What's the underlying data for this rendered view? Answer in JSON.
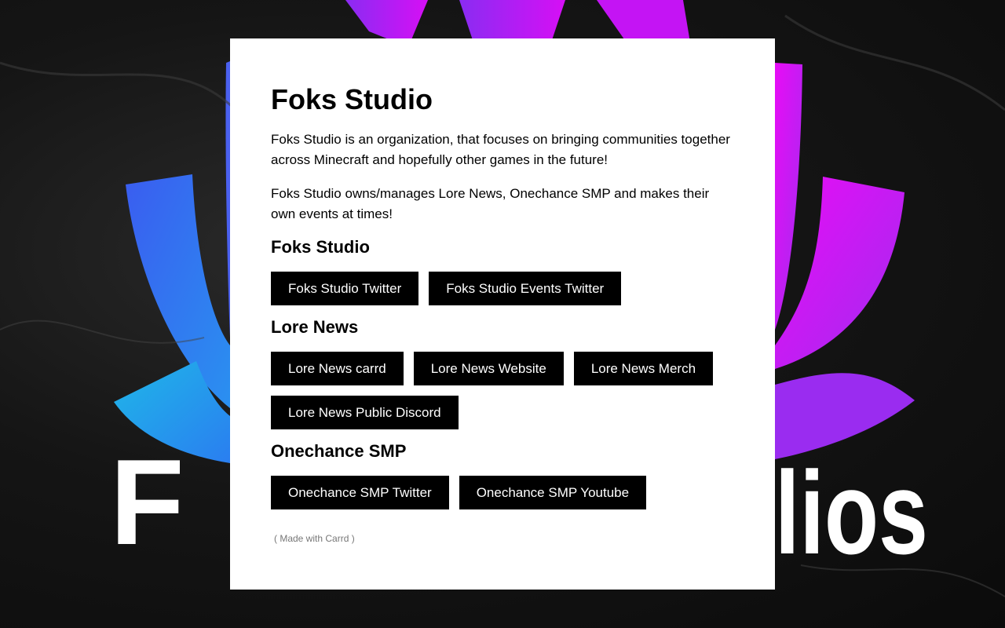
{
  "background": {
    "logo_text_left": "F",
    "logo_text_right": "lios",
    "colors": {
      "petal_blue": "#2f6ef0",
      "petal_cyan": "#19b8e6",
      "petal_purple": "#9b2cf2",
      "petal_magenta": "#e20cf5",
      "card_bg": "#ffffff",
      "button_bg": "#000000",
      "button_text": "#ffffff"
    }
  },
  "header": {
    "title": "Foks Studio"
  },
  "intro": {
    "paragraph_1": "Foks Studio is an organization, that focuses on bringing communities together across Minecraft and hopefully other games in the future!",
    "paragraph_2": "Foks Studio owns/manages Lore News, Onechance SMP and makes their own events at times!"
  },
  "sections": {
    "foks": {
      "heading": "Foks Studio",
      "buttons": [
        "Foks Studio Twitter",
        "Foks Studio Events Twitter"
      ]
    },
    "lore": {
      "heading": "Lore News",
      "buttons": [
        "Lore News carrd",
        "Lore News Website",
        "Lore News Merch",
        "Lore News Public Discord"
      ]
    },
    "onechance": {
      "heading": "Onechance SMP",
      "buttons": [
        "Onechance SMP Twitter",
        "Onechance SMP Youtube"
      ]
    }
  },
  "footer": {
    "made_with": "( Made with Carrd )"
  }
}
